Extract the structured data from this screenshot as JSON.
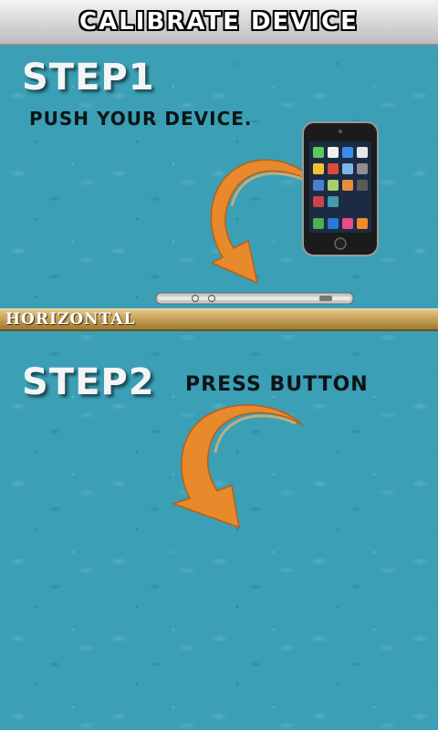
{
  "header": {
    "title": "CALIBRATE DEVICE"
  },
  "step1": {
    "title": "STEP1",
    "instruction": "PUSH YOUR DEVICE."
  },
  "level": {
    "label": "HORIZONTAL"
  },
  "step2": {
    "title": "STEP2",
    "instruction": "PRESS BUTTON"
  },
  "colors": {
    "background": "#3b9fb6",
    "arrow": "#e8892c",
    "level_bar": "#c8a359"
  }
}
